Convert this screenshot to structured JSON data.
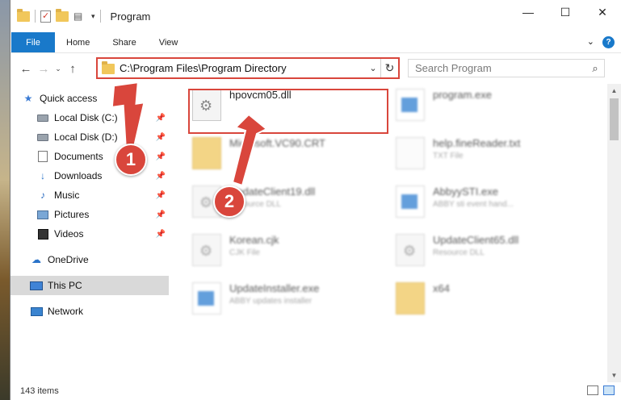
{
  "window": {
    "title": "Program",
    "controls": {
      "minimize": "—",
      "maximize": "☐",
      "close": "✕"
    }
  },
  "ribbon": {
    "tabs": [
      "File",
      "Home",
      "Share",
      "View"
    ],
    "help": "?",
    "expand": "⌄"
  },
  "address": {
    "path": "C:\\Program Files\\Program Directory",
    "dropdown": "⌄",
    "refresh": "↻"
  },
  "search": {
    "placeholder": "Search Program"
  },
  "nav": {
    "items": [
      {
        "label": "Quick access",
        "icon": "star-icon"
      },
      {
        "label": "Local Disk (C:)",
        "icon": "drive-icon",
        "pinned": true
      },
      {
        "label": "Local Disk (D:)",
        "icon": "drive-icon",
        "pinned": true
      },
      {
        "label": "Documents",
        "icon": "document-icon",
        "pinned": true
      },
      {
        "label": "Downloads",
        "icon": "download-icon",
        "pinned": true
      },
      {
        "label": "Music",
        "icon": "music-icon",
        "pinned": true
      },
      {
        "label": "Pictures",
        "icon": "picture-icon",
        "pinned": true
      },
      {
        "label": "Videos",
        "icon": "video-icon",
        "pinned": true
      },
      {
        "label": "OneDrive",
        "icon": "cloud-icon"
      },
      {
        "label": "This PC",
        "icon": "pc-icon",
        "selected": true
      },
      {
        "label": "Network",
        "icon": "network-icon"
      }
    ]
  },
  "files": [
    {
      "name": "hpovcm05.dll",
      "type": "",
      "icon": "gear-file-icon"
    },
    {
      "name": "program.exe",
      "type": "",
      "icon": "exe-icon"
    },
    {
      "name": "Microsoft.VC90.CRT",
      "type": "",
      "icon": "folder-icon"
    },
    {
      "name": "help.fineReader.txt",
      "type": "TXT File",
      "icon": "text-file-icon"
    },
    {
      "name": "UpdateClient19.dll",
      "type": "Resource DLL",
      "icon": "gear-file-icon"
    },
    {
      "name": "AbbyySTI.exe",
      "type": "ABBY sti event hand...",
      "icon": "exe-icon"
    },
    {
      "name": "Korean.cjk",
      "type": "CJK File",
      "icon": "gear-file-icon"
    },
    {
      "name": "UpdateClient65.dll",
      "type": "Resource DLL",
      "icon": "gear-file-icon"
    },
    {
      "name": "UpdateInstaller.exe",
      "type": "ABBY updates installer",
      "icon": "exe-icon"
    },
    {
      "name": "x64",
      "type": "",
      "icon": "folder-icon"
    }
  ],
  "status": {
    "count": "143 items"
  },
  "callouts": {
    "one": "1",
    "two": "2"
  },
  "colors": {
    "accent": "#1979ca",
    "highlight": "#d9463c"
  }
}
